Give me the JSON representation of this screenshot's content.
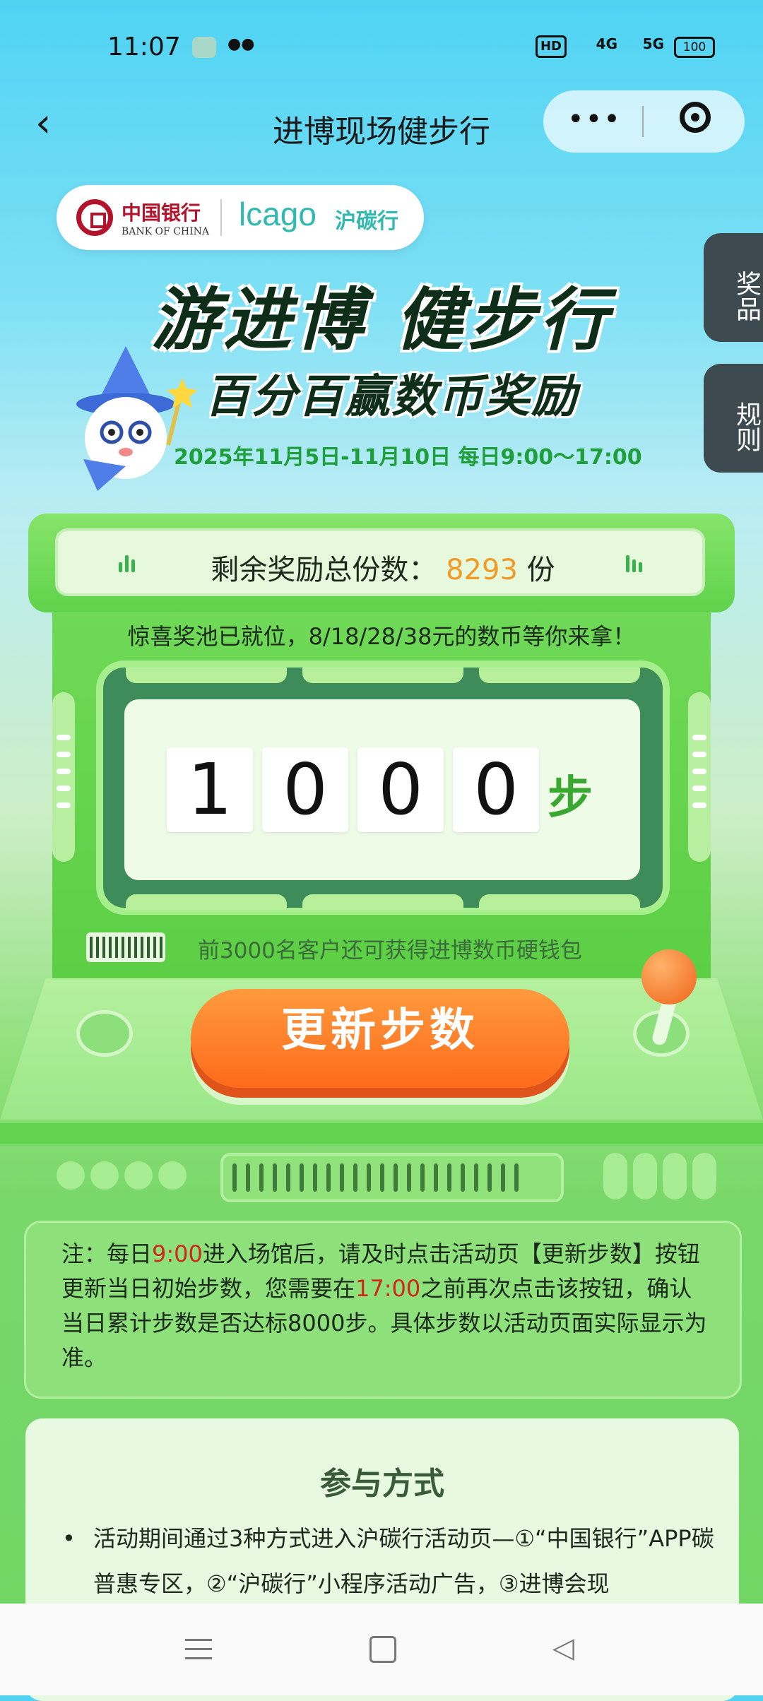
{
  "status_bar": {
    "time": "11:07",
    "network_hd": "HD",
    "network_4g": "4G",
    "network_5g": "5G",
    "battery": "100"
  },
  "title_bar": {
    "title": "进博现场健步行",
    "more": "•••"
  },
  "logos": {
    "boc_cn": "中国银行",
    "boc_en": "BANK OF CHINA",
    "icago": "lcago",
    "hutanxing": "沪碳行"
  },
  "side_tabs": [
    {
      "label": "奖品"
    },
    {
      "label": "规则"
    }
  ],
  "banner": {
    "headline": "游进博 健步行",
    "subheadline": "百分百赢数币奖励",
    "date": "2025年11月5日-11月10日 每日9:00～17:00"
  },
  "counter": {
    "label": "剩余奖励总份数：",
    "value": "8293",
    "unit": "份"
  },
  "pool_text": "惊喜奖池已就位，8/18/28/38元的数币等你来拿！",
  "steps": {
    "digits": [
      "1",
      "0",
      "0",
      "0"
    ],
    "unit": "步"
  },
  "wallet_text": "前3000名客户还可获得进博数币硬钱包",
  "update_button": "更新步数",
  "note": {
    "p1": "注：每日",
    "t1": "9:00",
    "p2": "进入场馆后，请及时点击活动页【更新步数】按钮更新当日初始步数，您需要在",
    "t2": "17:00",
    "p3": "之前再次点击该按钮，确认当日累计步数是否达标8000步。具体步数以活动页面实际显示为准。"
  },
  "participation": {
    "title": "参与方式",
    "bullet": "•",
    "text": "活动期间通过3种方式进入沪碳行活动页—①“中国银行”APP碳普惠专区，②“沪碳行”小程序活动广告，③进博会现"
  },
  "colors": {
    "accent_orange": "#ff7a24",
    "count_orange": "#f29a26",
    "green": "#3aa830",
    "note_red": "#d0271a"
  }
}
